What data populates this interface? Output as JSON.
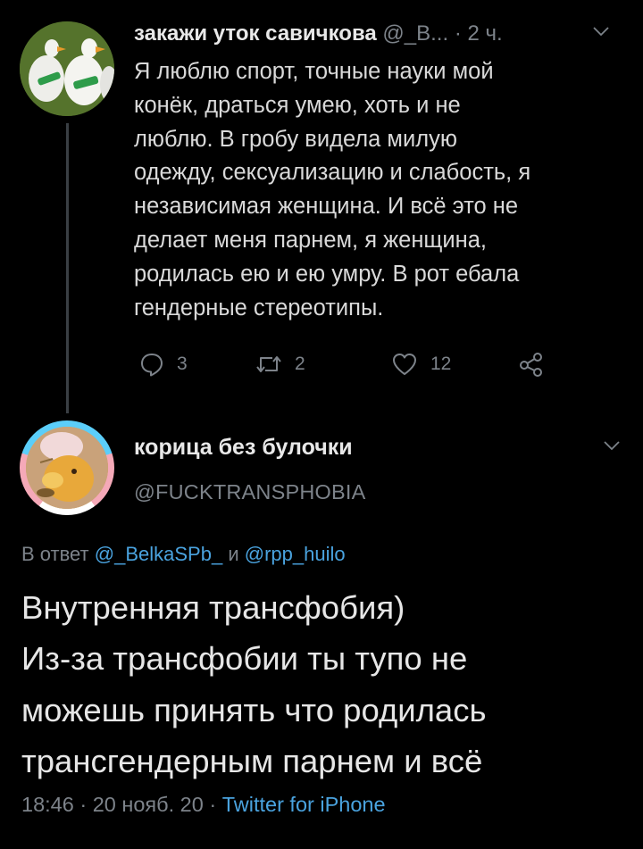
{
  "parent_tweet": {
    "display_name": "закажи уток савичкова",
    "handle": "@_В...",
    "separator": "·",
    "time_ago": "2 ч.",
    "body_lines": [
      "Я люблю спорт, точные науки мой",
      "конёк, драться умею, хоть и не",
      "люблю. В гробу видела милую",
      "одежду, сексуализацию и слабость, я",
      "независимая женщина. И всё это не",
      "делает меня парнем, я женщина,",
      "родилась ею и ею умру. В рот ебала",
      "гендерные стереотипы."
    ],
    "actions": {
      "reply_count": "3",
      "retweet_count": "2",
      "like_count": "12"
    }
  },
  "main_tweet": {
    "display_name": "корица без булочки",
    "handle": "@FUCKTRANSPHOBIA",
    "reply_prefix": "В ответ",
    "reply_user_1": "@_BelkaSPb_",
    "reply_conjunction": "и",
    "reply_user_2": "@rpp_huilo",
    "body_lines": [
      "Внутренняя трансфобия)",
      "Из-за трансфобии ты тупо не",
      "можешь принять что родилась",
      "трансгендерным парнем и всё"
    ],
    "time": "18:46",
    "date": "20 нояб. 20",
    "separator": "·",
    "source": "Twitter for iPhone"
  },
  "icons": {
    "reply": "reply-icon",
    "retweet": "retweet-icon",
    "like": "heart-icon",
    "share": "share-icon",
    "menu": "chevron-down-icon"
  },
  "colors": {
    "background": "#000000",
    "text_primary": "#e6e6e6",
    "text_secondary": "#7d838a",
    "link": "#4aa3df",
    "thread_line": "#3a3f44"
  }
}
